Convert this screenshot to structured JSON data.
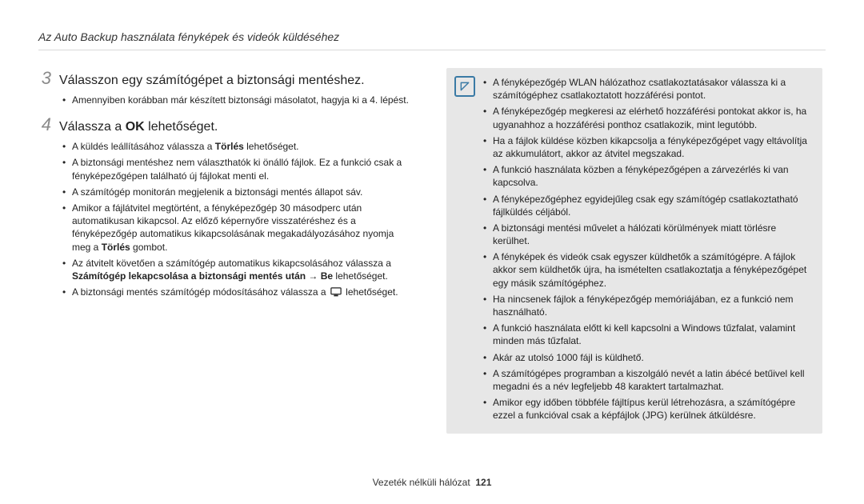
{
  "header": {
    "title": "Az Auto Backup használata fényképek és videók küldéséhez"
  },
  "steps": {
    "s3": {
      "num": "3",
      "title": "Válasszon egy számítógépet a biztonsági mentéshez.",
      "bullets": [
        "Amennyiben korábban már készített biztonsági másolatot, hagyja ki a 4. lépést."
      ]
    },
    "s4": {
      "num": "4",
      "title_pre": "Válassza a ",
      "title_bold": "OK",
      "title_post": " lehetőséget.",
      "b1_pre": "A küldés leállításához válassza a ",
      "b1_bold": "Törlés",
      "b1_post": " lehetőséget.",
      "b2": "A biztonsági mentéshez nem választhatók ki önálló fájlok. Ez a funkció csak a fényképezőgépen található új fájlokat menti el.",
      "b3": "A számítógép monitorán megjelenik a biztonsági mentés állapot sáv.",
      "b4_pre": "Amikor a fájlátvitel megtörtént, a fényképezőgép 30 másodperc után automatikusan kikapcsol. Az előző képernyőre visszatéréshez és a fényképezőgép automatikus kikapcsolásának megakadályozásához nyomja meg a ",
      "b4_bold": "Törlés",
      "b4_post": " gombot.",
      "b5_pre": "Az átvitelt követően a számítógép automatikus kikapcsolásához válassza a ",
      "b5_bold": "Számítógép lekapcsolása a biztonsági mentés után → Be",
      "b5_post": " lehetőséget.",
      "b6_pre": "A biztonsági mentés számítógép módosításához válassza a ",
      "b6_post": " lehetőséget."
    }
  },
  "note": {
    "items": [
      "A fényképezőgép WLAN hálózathoz csatlakoztatásakor válassza ki a számítógéphez csatlakoztatott hozzáférési pontot.",
      "A fényképezőgép megkeresi az elérhető hozzáférési pontokat akkor is, ha ugyanahhoz a hozzáférési ponthoz csatlakozik, mint legutóbb.",
      "Ha a fájlok küldése közben kikapcsolja a fényképezőgépet vagy eltávolítja az akkumulátort, akkor az átvitel megszakad.",
      "A funkció használata közben a fényképezőgépen a zárvezérlés ki van kapcsolva.",
      "A fényképezőgéphez egyidejűleg csak egy számítógép csatlakoztatható fájlküldés céljából.",
      "A biztonsági mentési művelet a hálózati körülmények miatt törlésre kerülhet.",
      "A fényképek és videók csak egyszer küldhetők a számítógépre. A fájlok akkor sem küldhetők újra, ha ismételten csatlakoztatja a fényképezőgépet egy másik számítógéphez.",
      "Ha nincsenek fájlok a fényképezőgép memóriájában, ez a funkció nem használható.",
      "A funkció használata előtt ki kell kapcsolni a Windows tűzfalat, valamint minden más tűzfalat.",
      "Akár az utolsó 1000 fájl is küldhető.",
      "A számítógépes programban a kiszolgáló nevét a latin ábécé betűivel kell megadni és a név legfeljebb 48 karaktert tartalmazhat.",
      "Amikor egy időben többféle fájltípus kerül létrehozásra, a számítógépre ezzel a funkcióval csak a képfájlok (JPG) kerülnek átküldésre."
    ]
  },
  "footer": {
    "section": "Vezeték nélküli hálózat",
    "page": "121"
  }
}
